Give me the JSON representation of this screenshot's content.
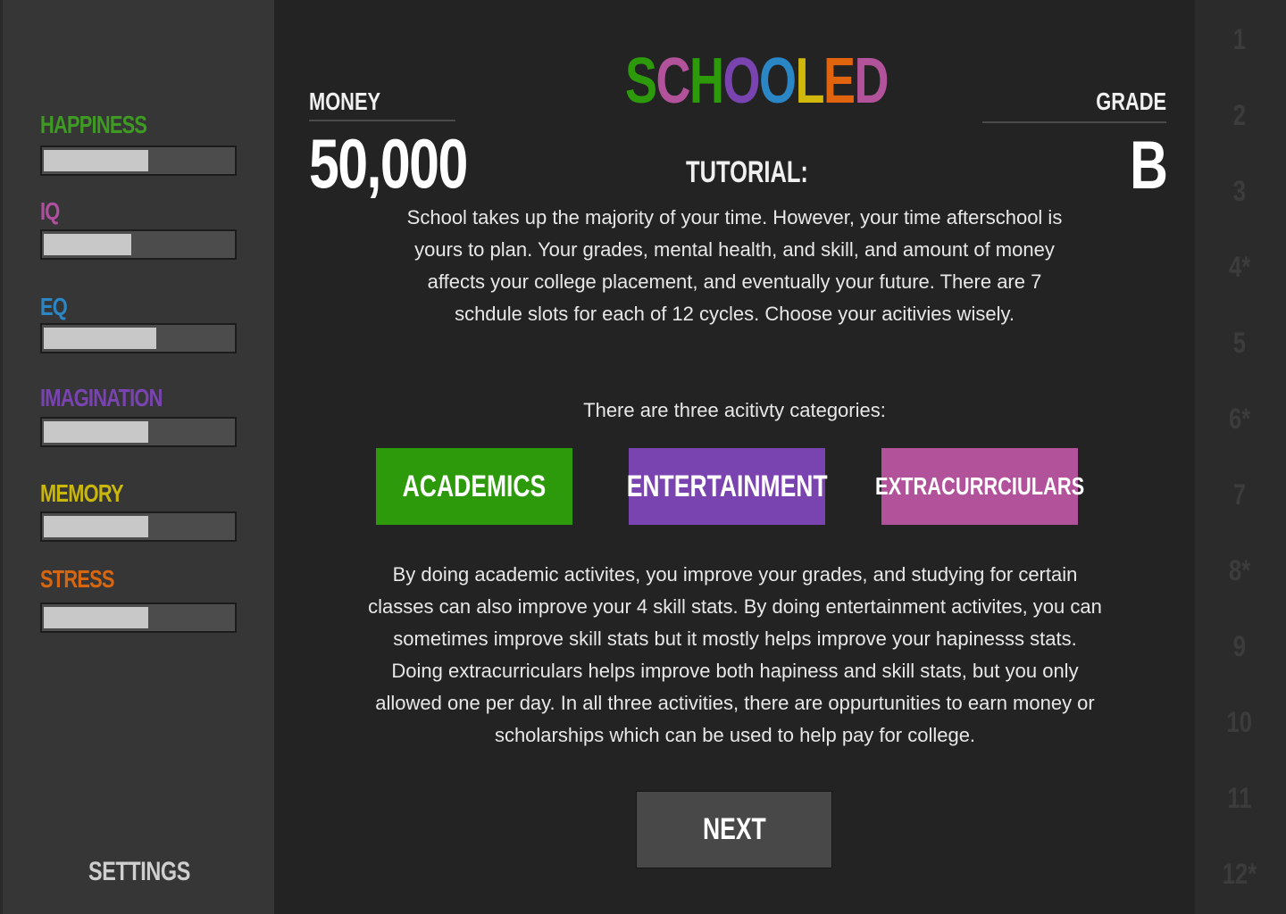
{
  "title": {
    "letters": [
      {
        "char": "S",
        "color": "#2c9a0b"
      },
      {
        "char": "C",
        "color": "#b2529a"
      },
      {
        "char": "H",
        "color": "#2c9a0b"
      },
      {
        "char": "O",
        "color": "#7a44b0"
      },
      {
        "char": "O",
        "color": "#2b86c6"
      },
      {
        "char": "L",
        "color": "#d2b80c"
      },
      {
        "char": "E",
        "color": "#e0640e"
      },
      {
        "char": "D",
        "color": "#b2529a"
      }
    ]
  },
  "stats": [
    {
      "label": "HAPPINESS",
      "color": "#3e9a23",
      "fill": 0.56
    },
    {
      "label": "IQ",
      "color": "#b04fa0",
      "fill": 0.47
    },
    {
      "label": "EQ",
      "color": "#2b86c6",
      "fill": 0.6
    },
    {
      "label": "IMAGINATION",
      "color": "#7a44b0",
      "fill": 0.56
    },
    {
      "label": "MEMORY",
      "color": "#c9b70c",
      "fill": 0.56
    },
    {
      "label": "STRESS",
      "color": "#d6660f",
      "fill": 0.56
    }
  ],
  "settings_label": "SETTINGS",
  "money": {
    "label": "MONEY",
    "value": "50,000"
  },
  "grade": {
    "label": "GRADE",
    "value": "B"
  },
  "tutorial_label": "TUTORIAL:",
  "tutorial": {
    "intro": "School takes up the majority of your time. However, your time afterschool is yours to plan. Your grades, mental health, and skill, and amount of money affects your college placement, and eventually your future. There are 7 schdule slots for each of 12 cycles. Choose your acitivies wisely.",
    "categories_intro": "There are three acitivty categories:",
    "details": "By doing academic activites, you improve your grades, and studying for certain classes can also improve your 4 skill stats. By doing entertainment activites, you can sometimes improve skill stats but it mostly helps improve your hapinesss stats. Doing extracurriculars helps improve both hapiness and skill stats, but you only allowed one per day. In all three activities, there are oppurtunities to earn money or scholarships which can be used to help pay for college."
  },
  "categories": {
    "academics": "ACADEMICS",
    "entertainment": "ENTERTAINMENT",
    "extracurriculars": "EXTRACURRCIULARS"
  },
  "next_label": "NEXT",
  "cycles": [
    "1",
    "2",
    "3",
    "4*",
    "5",
    "6*",
    "7",
    "8*",
    "9",
    "10",
    "11",
    "12*"
  ]
}
